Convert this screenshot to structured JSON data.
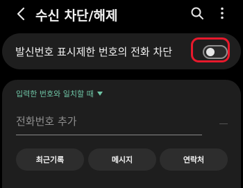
{
  "header": {
    "title": "수신 차단/해제"
  },
  "block_unknown": {
    "label": "발신번호 표시제한 번호의 전화 차단",
    "enabled": false
  },
  "number_entry": {
    "match_mode": "입력한 번호와 일치할 때",
    "placeholder": "전화번호 추가"
  },
  "sources": {
    "recent": "최근기록",
    "messages": "메시지",
    "contacts": "연락처"
  },
  "icons": {
    "back": "chevron-left-icon",
    "search": "search-icon",
    "more": "more-vertical-icon"
  },
  "colors": {
    "background": "#000000",
    "card": "#1e1e1e",
    "accent": "#6fc5a6",
    "highlight": "#e8192c"
  }
}
